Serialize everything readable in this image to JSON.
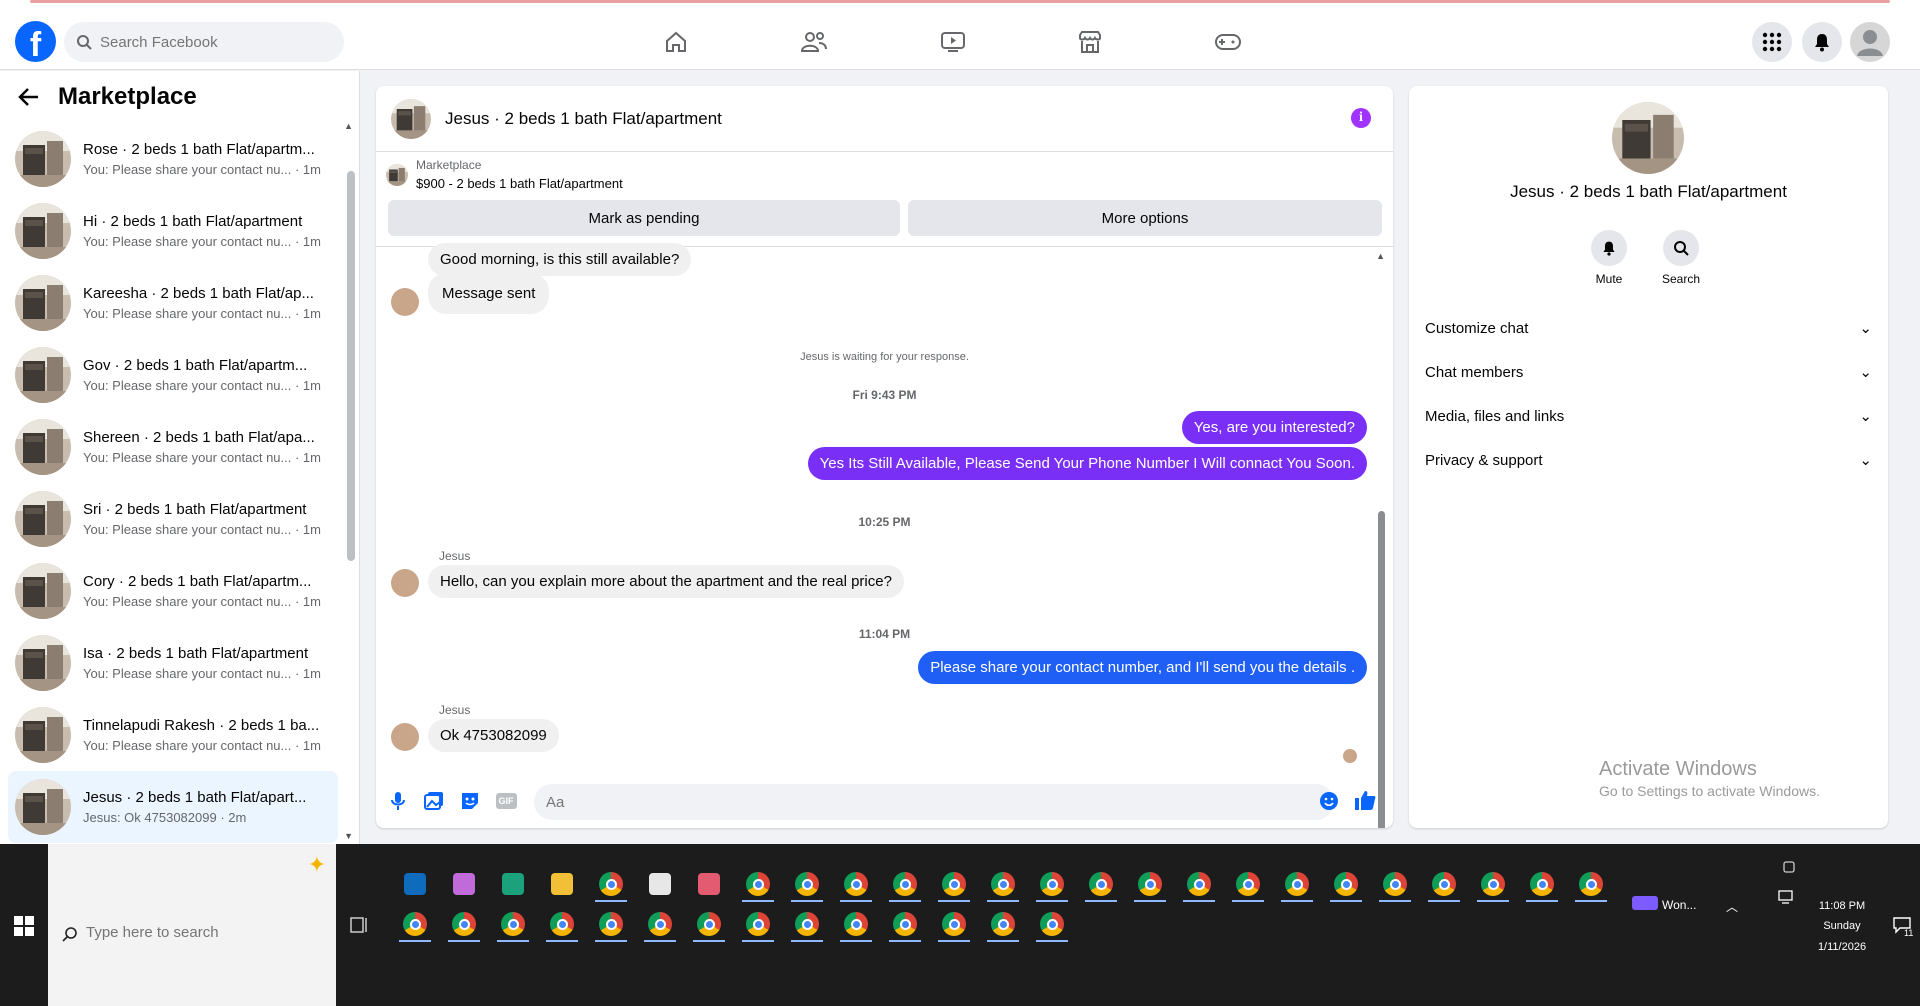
{
  "topbar": {
    "search_placeholder": "Search Facebook",
    "nav": [
      "home-icon",
      "friends-icon",
      "video-icon",
      "marketplace-icon",
      "gaming-icon"
    ],
    "logo": "f"
  },
  "left": {
    "title": "Marketplace",
    "conversations": [
      {
        "title": "Rose · 2 beds 1 bath Flat/apartm...",
        "preview": "You: Please share your contact nu...",
        "time": " · 1m"
      },
      {
        "title": "Hi · 2 beds 1 bath Flat/apartment",
        "preview": "You: Please share your contact nu...",
        "time": " · 1m"
      },
      {
        "title": "Kareesha · 2 beds 1 bath Flat/ap...",
        "preview": "You: Please share your contact nu...",
        "time": " · 1m"
      },
      {
        "title": "Gov · 2 beds 1 bath Flat/apartm...",
        "preview": "You: Please share your contact nu...",
        "time": " · 1m"
      },
      {
        "title": "Shereen · 2 beds 1 bath Flat/apa...",
        "preview": "You: Please share your contact nu...",
        "time": " · 1m"
      },
      {
        "title": "Sri · 2 beds 1 bath Flat/apartment",
        "preview": "You: Please share your contact nu...",
        "time": " · 1m"
      },
      {
        "title": "Cory · 2 beds 1 bath Flat/apartm...",
        "preview": "You: Please share your contact nu...",
        "time": " · 1m"
      },
      {
        "title": "Isa · 2 beds 1 bath Flat/apartment",
        "preview": "You: Please share your contact nu...",
        "time": " · 1m"
      },
      {
        "title": "Tinnelapudi Rakesh · 2 beds 1 ba...",
        "preview": "You: Please share your contact nu...",
        "time": " · 1m"
      },
      {
        "title": "Jesus · 2 beds 1 bath Flat/apart...",
        "preview": "Jesus: Ok 4753082099",
        "time": " · 2m"
      }
    ]
  },
  "chat": {
    "title": "Jesus · 2 beds 1 bath Flat/apartment",
    "marketplace_label": "Marketplace",
    "listing": "$900 - 2 beds 1 bath Flat/apartment",
    "mark_pending": "Mark as pending",
    "more_options": "More options",
    "messages": {
      "m1": "Good morning, is this still available?",
      "m2": "Message sent",
      "waiting": "Jesus is waiting for your response.",
      "ts1": "Fri 9:43 PM",
      "m3": "Yes, are you interested?",
      "m4": "Yes Its Still Available, Please Send Your Phone Number I Will connact You Soon.",
      "ts2": "10:25 PM",
      "sender1": "Jesus",
      "m5": "Hello, can you explain more about the apartment and the real price?",
      "ts3": "11:04 PM",
      "m6": "Please share your contact number, and I'll send you the details .",
      "sender2": "Jesus",
      "m7": "Ok 4753082099"
    },
    "input_placeholder": "Aa",
    "gif": "GIF"
  },
  "info": {
    "name": "Jesus · 2 beds 1 bath Flat/apartment",
    "mute": "Mute",
    "search": "Search",
    "sections": [
      "Customize chat",
      "Chat members",
      "Media, files and links",
      "Privacy & support"
    ],
    "activate_title": "Activate Windows",
    "activate_sub": "Go to Settings to activate Windows."
  },
  "taskbar": {
    "search_placeholder": "Type here to search",
    "widget": "Won...",
    "time": "11:08 PM",
    "day": "Sunday",
    "date": "1/11/2026",
    "notif_count": "11"
  },
  "colors": {
    "accent_blue": "#0866ff",
    "bubble_purple": "#7a2ff7",
    "bubble_blue": "#1f5ff5"
  }
}
